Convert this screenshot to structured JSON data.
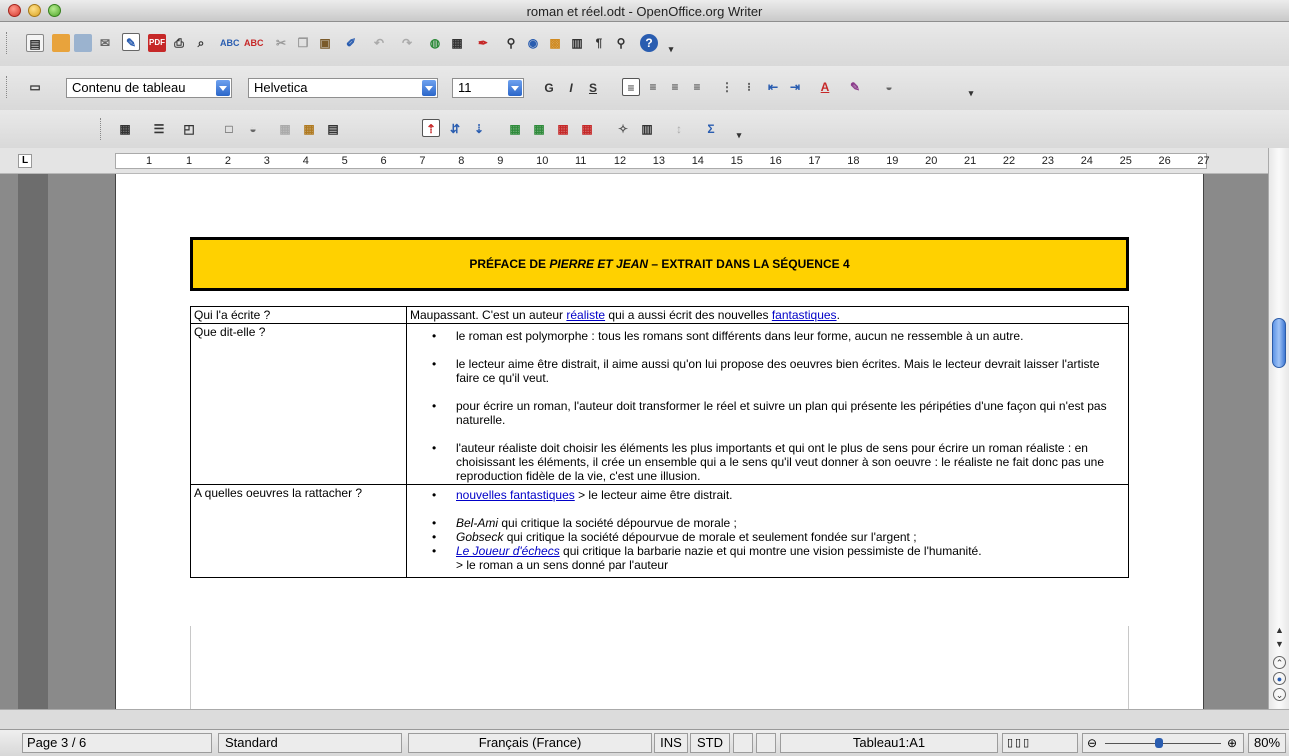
{
  "window": {
    "title": "roman et réel.odt - OpenOffice.org Writer"
  },
  "format_bar": {
    "paragraph_style": "Contenu de tableau",
    "font_name": "Helvetica",
    "font_size": "11"
  },
  "ruler": {
    "ticks": [
      "1",
      "1",
      "2",
      "3",
      "4",
      "5",
      "6",
      "7",
      "8",
      "9",
      "10",
      "11",
      "12",
      "13",
      "14",
      "15",
      "16",
      "17",
      "18",
      "19",
      "20",
      "21",
      "22",
      "23",
      "24",
      "25",
      "26",
      "27"
    ]
  },
  "document": {
    "banner_prefix": "PRÉFACE DE ",
    "banner_italic": "PIERRE ET JEAN",
    "banner_suffix": " – EXTRAIT DANS LA SÉQUENCE 4",
    "row1": {
      "label": "Qui l'a écrite ?",
      "text_a": "Maupassant. C'est un auteur ",
      "link_a": "réaliste",
      "text_b": " qui a aussi écrit des nouvelles ",
      "link_b": "fantastiques",
      "text_c": "."
    },
    "row2": {
      "label": "Que dit-elle ?",
      "items": [
        "le roman est polymorphe : tous les romans sont différents dans leur forme, aucun ne ressemble à un autre.",
        "le lecteur aime être distrait, il aime aussi qu'on lui propose des oeuvres bien écrites. Mais le lecteur devrait laisser l'artiste faire ce qu'il veut.",
        "pour écrire un roman, l'auteur doit transformer le réel et suivre un plan qui présente les péripéties d'une façon qui n'est pas naturelle.",
        "l'auteur réaliste doit choisir les éléments les plus importants et qui ont le plus de sens pour écrire un roman réaliste : en choisissant les éléments, il crée un ensemble qui a le sens qu'il veut donner à son oeuvre : le réaliste ne fait donc pas une reproduction fidèle de la vie, c'est une illusion."
      ]
    },
    "row3": {
      "label": "A quelles oeuvres la rattacher ?",
      "item1_link": "nouvelles fantastiques",
      "item1_text": " > le lecteur aime être distrait.",
      "item2_italic": "Bel-Ami",
      "item2_text": " qui critique la société dépourvue de morale ;",
      "item3_italic": "Gobseck",
      "item3_text": " qui critique la société dépourvue de morale et seulement fondée sur l'argent ;",
      "item4_link": "Le Joueur d'échecs",
      "item4_text": " qui critique la barbarie nazie et qui montre une vision pessimiste de l'humanité.",
      "item4_line2": "> le roman a un sens donné par l'auteur"
    }
  },
  "status_bar": {
    "page": "Page 3 / 6",
    "style": "Standard",
    "language": "Français (France)",
    "insert_mode": "INS",
    "selection_mode": "STD",
    "cell": "Tableau1:A1",
    "zoom": "80%"
  },
  "icons": [
    "new-icon",
    "open-icon",
    "save-icon",
    "email-icon",
    "edit-icon",
    "pdf-icon",
    "print-icon",
    "preview-icon",
    "spellcheck-icon",
    "autospell-icon",
    "cut-icon",
    "copy-icon",
    "paste-icon",
    "clone-format-icon",
    "undo-icon",
    "redo-icon",
    "hyperlink-icon",
    "table-icon",
    "draw-icon",
    "find-icon",
    "navigator-icon",
    "gallery-icon",
    "datasource-icon",
    "formatting-marks-icon",
    "zoom-icon",
    "help-icon"
  ]
}
